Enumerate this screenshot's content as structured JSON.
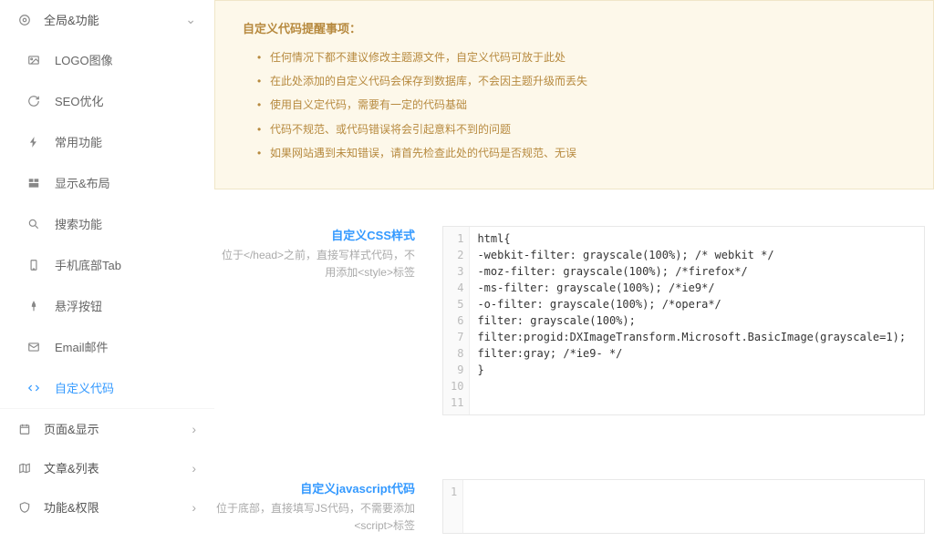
{
  "sidebar": {
    "sections": [
      {
        "label": "全局&功能",
        "expanded": true,
        "items": [
          {
            "label": "LOGO图像",
            "icon": "image"
          },
          {
            "label": "SEO优化",
            "icon": "refresh"
          },
          {
            "label": "常用功能",
            "icon": "bolt"
          },
          {
            "label": "显示&布局",
            "icon": "layout"
          },
          {
            "label": "搜索功能",
            "icon": "search"
          },
          {
            "label": "手机底部Tab",
            "icon": "mobile"
          },
          {
            "label": "悬浮按钮",
            "icon": "pin"
          },
          {
            "label": "Email邮件",
            "icon": "mail"
          },
          {
            "label": "自定义代码",
            "icon": "code",
            "active": true
          }
        ]
      },
      {
        "label": "页面&显示",
        "icon": "calendar"
      },
      {
        "label": "文章&列表",
        "icon": "map"
      },
      {
        "label": "功能&权限",
        "icon": "shield"
      }
    ]
  },
  "notice": {
    "title": "自定义代码提醒事项：",
    "items": [
      "任何情况下都不建议修改主题源文件，自定义代码可放于此处",
      "在此处添加的自定义代码会保存到数据库，不会因主题升级而丢失",
      "使用自义定代码，需要有一定的代码基础",
      "代码不规范、或代码错误将会引起意料不到的问题",
      "如果网站遇到未知错误，请首先检查此处的代码是否规范、无误"
    ]
  },
  "fields": {
    "css": {
      "title": "自定义CSS样式",
      "desc": "位于</head>之前，直接写样式代码，不用添加<style>标签",
      "lines": [
        "html{",
        "-webkit-filter: grayscale(100%); /* webkit */",
        "-moz-filter: grayscale(100%); /*firefox*/",
        "-ms-filter: grayscale(100%); /*ie9*/",
        "-o-filter: grayscale(100%); /*opera*/",
        "filter: grayscale(100%);",
        "filter:progid:DXImageTransform.Microsoft.BasicImage(grayscale=1);",
        "filter:gray; /*ie9- */",
        "}",
        "",
        ""
      ]
    },
    "js": {
      "title": "自定义javascript代码",
      "desc": "位于底部，直接填写JS代码，不需要添加<script>标签",
      "lines": [
        ""
      ]
    }
  }
}
